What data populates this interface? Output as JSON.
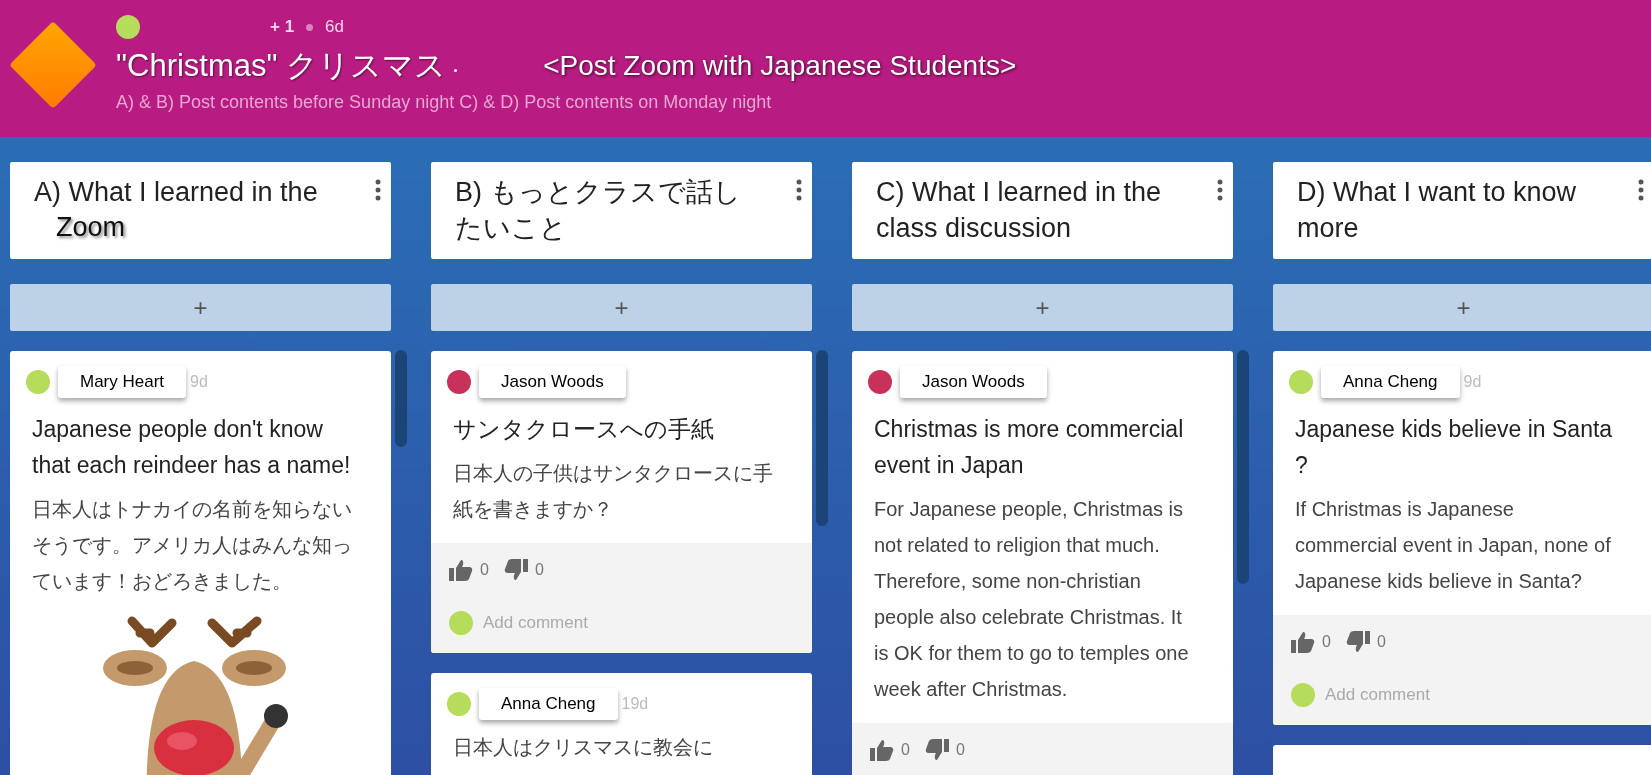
{
  "header": {
    "avatar": {
      "color": "#b5dc5a"
    },
    "plus": "+ 1",
    "age": "6d",
    "title": "\"Christmas\" クリスマス",
    "title_extra": "<Post Zoom with Japanese Students>",
    "subtitle": "A) & B) Post contents before Sunday night C) & D) Post contents on Monday night"
  },
  "columns": [
    {
      "title": "A) What I learned in the",
      "title_overlay": "Zoom",
      "add": "+",
      "posts": [
        {
          "kind": "note",
          "author": "Mary Heart",
          "color": "#b5dc5a",
          "time": "9d",
          "title": "Japanese people don't know that each reindeer has a name!",
          "body": "日本人はトナカイの名前を知らないそうです。アメリカ人はみんな知っています！おどろきました。"
        }
      ]
    },
    {
      "title": "B) もっとクラスで話したいこと",
      "add": "+",
      "posts": [
        {
          "kind": "note",
          "author": "Jason Woods",
          "color": "#c8325a",
          "title": "サンタクロースへの手紙",
          "body": "日本人の子供はサンタクロースに手紙を書きますか？",
          "likes": "0",
          "dislikes": "0",
          "comment_placeholder": "Add comment",
          "comment_avatar": {
            "color": "#b5dc5a"
          }
        },
        {
          "kind": "note",
          "author": "Anna Cheng",
          "color": "#b5dc5a",
          "time": "19d",
          "body": "日本人はクリスマスに教会に"
        }
      ]
    },
    {
      "title": "C) What I learned in the class discussion",
      "add": "+",
      "posts": [
        {
          "kind": "note",
          "author": "Jason Woods",
          "color": "#c8325a",
          "title": "Christmas is more commercial event in Japan",
          "body": "For Japanese people, Christmas is not related to religion that much. Therefore, some non-christian people also celebrate Christmas.  It is OK for them to go to temples one week after Christmas.",
          "likes": "0",
          "dislikes": "0"
        }
      ]
    },
    {
      "title": "D) What I want to know more",
      "add": "+",
      "posts": [
        {
          "kind": "note",
          "author": "Anna Cheng",
          "color": "#b5dc5a",
          "time": "9d",
          "title": "Japanese kids believe in Santa ?",
          "body": "If Christmas is Japanese commercial event in Japan, none of Japanese kids believe in Santa?",
          "likes": "0",
          "dislikes": "0",
          "comment_placeholder": "Add comment",
          "comment_avatar": {
            "color": "#b5dc5a"
          }
        },
        {
          "kind": "stub"
        }
      ]
    }
  ]
}
